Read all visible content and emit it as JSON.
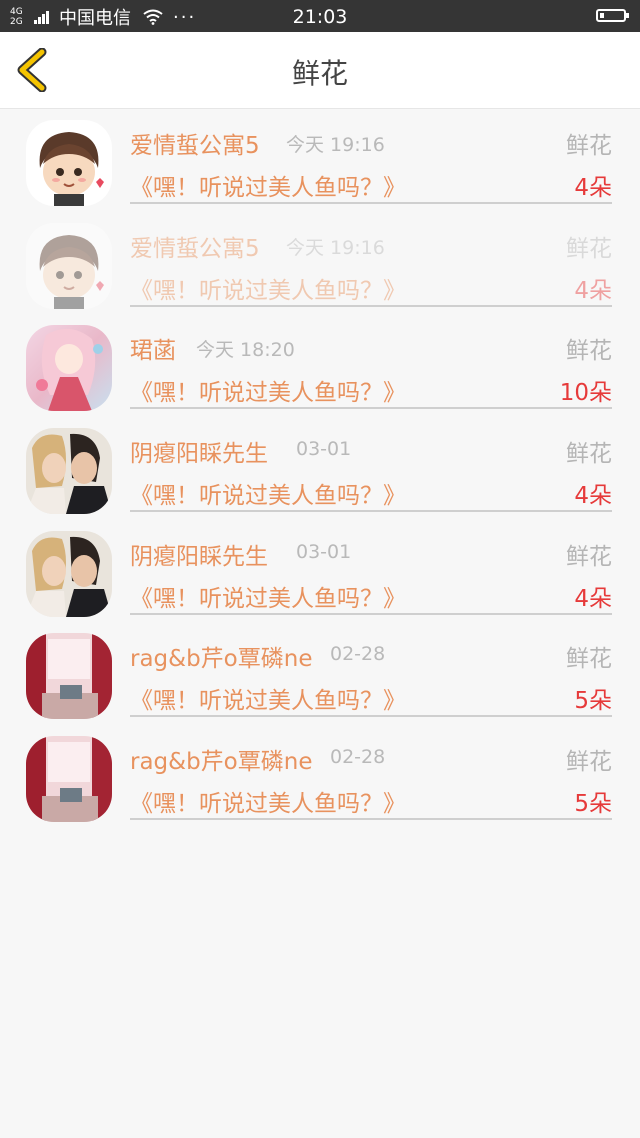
{
  "status_bar": {
    "network_top": "4G",
    "network_bottom": "2G",
    "carrier": "中国电信",
    "more": "···",
    "time": "21:03"
  },
  "header": {
    "title": "鲜花",
    "back_icon": "chevron-left-icon",
    "back_color": "#f0b400"
  },
  "colors": {
    "name": "#e8925e",
    "count": "#e63a3a",
    "meta": "#b9b9b9"
  },
  "items": [
    {
      "name": "爱情蜇公寓5",
      "time": "今天 19:16",
      "type": "鲜花",
      "message": "《嘿！听说过美人鱼吗？》",
      "count": "4朵"
    },
    {
      "name": "爱情蜇公寓5",
      "time": "今天 19:16",
      "type": "鲜花",
      "message": "《嘿！听说过美人鱼吗？》",
      "count": "4朵"
    },
    {
      "name": "珺菡",
      "time": "今天 18:20",
      "type": "鲜花",
      "message": "《嘿！听说过美人鱼吗？》",
      "count": "10朵"
    },
    {
      "name": "阴瘪阳睬先生",
      "time": "03-01",
      "type": "鲜花",
      "message": "《嘿！听说过美人鱼吗？》",
      "count": "4朵"
    },
    {
      "name": "阴瘪阳睬先生",
      "time": "03-01",
      "type": "鲜花",
      "message": "《嘿！听说过美人鱼吗？》",
      "count": "4朵"
    },
    {
      "name": "rag&b芹o覃磷ne",
      "time": "02-28",
      "type": "鲜花",
      "message": "《嘿！听说过美人鱼吗？》",
      "count": "5朵"
    },
    {
      "name": "rag&b芹o覃磷ne",
      "time": "02-28",
      "type": "鲜花",
      "message": "《嘿！听说过美人鱼吗？》",
      "count": "5朵"
    }
  ]
}
